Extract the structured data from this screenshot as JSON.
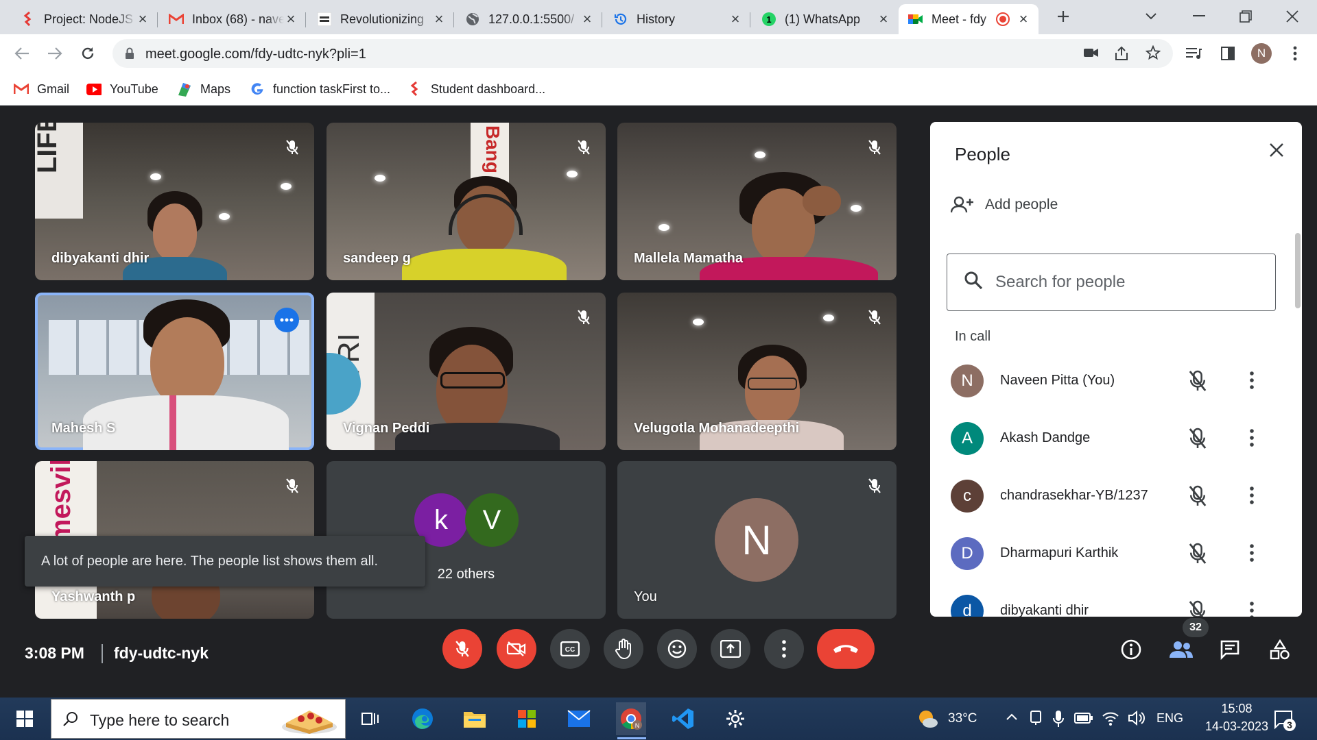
{
  "browser": {
    "tabs": [
      {
        "title": "Project: NodeJS",
        "active": false
      },
      {
        "title": "Inbox (68) - naveen",
        "active": false
      },
      {
        "title": "Revolutionizing",
        "active": false
      },
      {
        "title": "127.0.0.1:5500/",
        "active": false
      },
      {
        "title": "History",
        "active": false
      },
      {
        "title": "(1) WhatsApp",
        "active": false
      },
      {
        "title": "Meet - fdy",
        "active": true
      }
    ],
    "url": "meet.google.com/fdy-udtc-nyk?pli=1",
    "profile_initial": "N",
    "bookmarks": [
      {
        "label": "Gmail",
        "icon": "gmail-icon"
      },
      {
        "label": "YouTube",
        "icon": "youtube-icon"
      },
      {
        "label": "Maps",
        "icon": "maps-icon"
      },
      {
        "label": "function taskFirst to...",
        "icon": "google-icon"
      },
      {
        "label": "Student dashboard...",
        "icon": "ccbp-icon"
      }
    ]
  },
  "meet": {
    "tiles": [
      {
        "name": "dibyakanti dhir",
        "muted": true,
        "sign": "LIFE"
      },
      {
        "name": "sandeep g",
        "muted": true,
        "sign": "Bang"
      },
      {
        "name": "Mallela Mamatha",
        "muted": true
      },
      {
        "name": "Mahesh S",
        "muted": false,
        "speaking": true
      },
      {
        "name": "Vignan Peddi",
        "muted": true,
        "sign": "TRI"
      },
      {
        "name": "Velugotla Mohanadeepthi",
        "muted": true
      },
      {
        "name": "Yashwanth p",
        "muted": true,
        "sign": "mesvill"
      },
      {
        "name": "22 others",
        "avatars": [
          {
            "letter": "k",
            "color": "#7b1fa2"
          },
          {
            "letter": "V",
            "color": "#33691e"
          }
        ]
      },
      {
        "name": "You",
        "avatar_letter": "N",
        "avatar_color": "#8d6e63",
        "muted": true
      }
    ],
    "toast": "A lot of people are here. The people list shows them all.",
    "time": "3:08 PM",
    "meeting_code": "fdy-udtc-nyk",
    "participant_count": "32",
    "people_panel": {
      "title": "People",
      "add_people": "Add people",
      "search_placeholder": "Search for people",
      "section": "In call",
      "participants": [
        {
          "initial": "N",
          "name": "Naveen Pitta (You)",
          "color": "#8d6e63"
        },
        {
          "initial": "A",
          "name": "Akash Dandge",
          "color": "#00897b"
        },
        {
          "initial": "c",
          "name": "chandrasekhar-YB/1237",
          "color": "#5d4037"
        },
        {
          "initial": "D",
          "name": "Dharmapuri Karthik",
          "color": "#5c6bc0"
        },
        {
          "initial": "d",
          "name": "dibyakanti dhir",
          "color": "#0b57a5"
        }
      ]
    }
  },
  "taskbar": {
    "search_placeholder": "Type here to search",
    "weather": "33°C",
    "language": "ENG",
    "time": "15:08",
    "date": "14-03-2023",
    "notifications": "3"
  },
  "colors": {
    "meet_bg": "#202124",
    "danger": "#ea4335",
    "accent": "#1a73e8"
  }
}
